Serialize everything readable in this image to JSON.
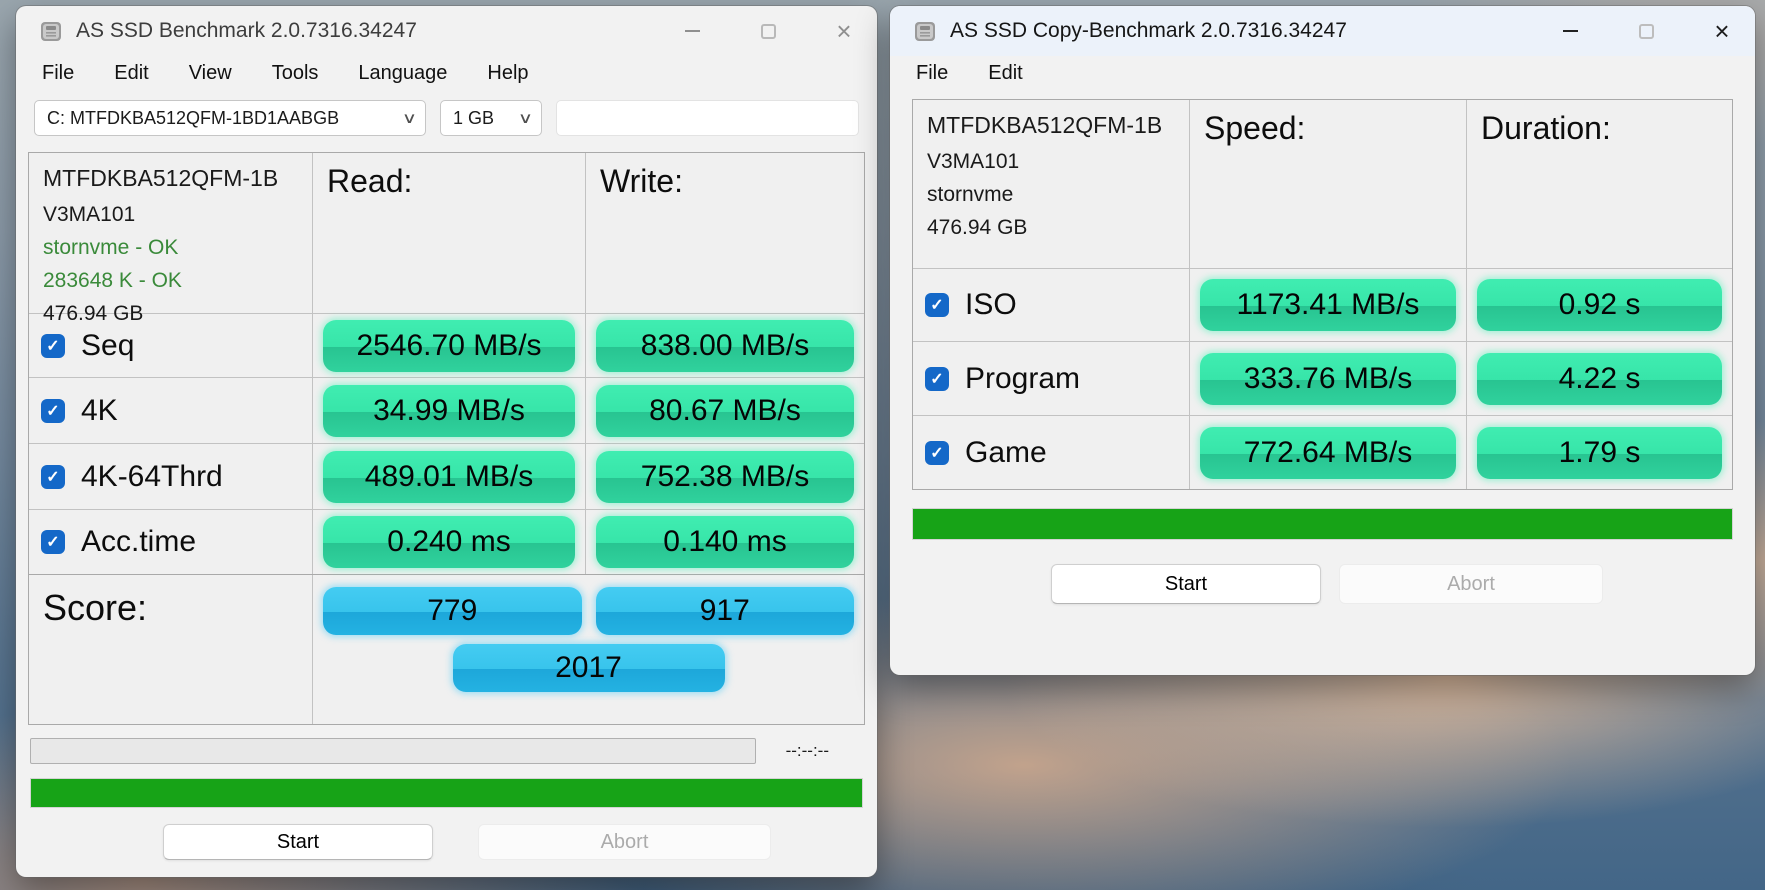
{
  "colors": {
    "badge_green_top": "#3BEAAD",
    "badge_green_bottom": "#29C794",
    "badge_blue_top": "#3CC9F0",
    "badge_blue_bottom": "#1FA9DC",
    "progress_green": "#17A317",
    "checkbox_blue": "#1468C8",
    "ok_text_green": "#3A8A3A",
    "active_titlebar": "#ECF2FA"
  },
  "left_window": {
    "title": "AS SSD Benchmark 2.0.7316.34247",
    "menu": [
      "File",
      "Edit",
      "View",
      "Tools",
      "Language",
      "Help"
    ],
    "drive_select_value": "C: MTFDKBA512QFM-1BD1AABGB",
    "test_size_value": "1 GB",
    "drive_info": {
      "model": "MTFDKBA512QFM-1B",
      "firmware": "V3MA101",
      "driver_status": "stornvme - OK",
      "offset_status": "283648 K - OK",
      "capacity": "476.94 GB"
    },
    "col_read": "Read:",
    "col_write": "Write:",
    "rows": [
      {
        "label": "Seq",
        "read": "2546.70 MB/s",
        "write": "838.00 MB/s"
      },
      {
        "label": "4K",
        "read": "34.99 MB/s",
        "write": "80.67 MB/s"
      },
      {
        "label": "4K-64Thrd",
        "read": "489.01 MB/s",
        "write": "752.38 MB/s"
      },
      {
        "label": "Acc.time",
        "read": "0.240 ms",
        "write": "0.140 ms"
      }
    ],
    "score_label": "Score:",
    "score_read": "779",
    "score_write": "917",
    "score_total": "2017",
    "timer": "--:--:--",
    "start_label": "Start",
    "abort_label": "Abort"
  },
  "right_window": {
    "title": "AS SSD Copy-Benchmark 2.0.7316.34247",
    "menu": [
      "File",
      "Edit"
    ],
    "drive_info": {
      "model": "MTFDKBA512QFM-1B",
      "firmware": "V3MA101",
      "driver": "stornvme",
      "capacity": "476.94 GB"
    },
    "col_speed": "Speed:",
    "col_duration": "Duration:",
    "rows": [
      {
        "label": "ISO",
        "speed": "1173.41 MB/s",
        "duration": "0.92 s"
      },
      {
        "label": "Program",
        "speed": "333.76 MB/s",
        "duration": "4.22 s"
      },
      {
        "label": "Game",
        "speed": "772.64 MB/s",
        "duration": "1.79 s"
      }
    ],
    "start_label": "Start",
    "abort_label": "Abort"
  }
}
